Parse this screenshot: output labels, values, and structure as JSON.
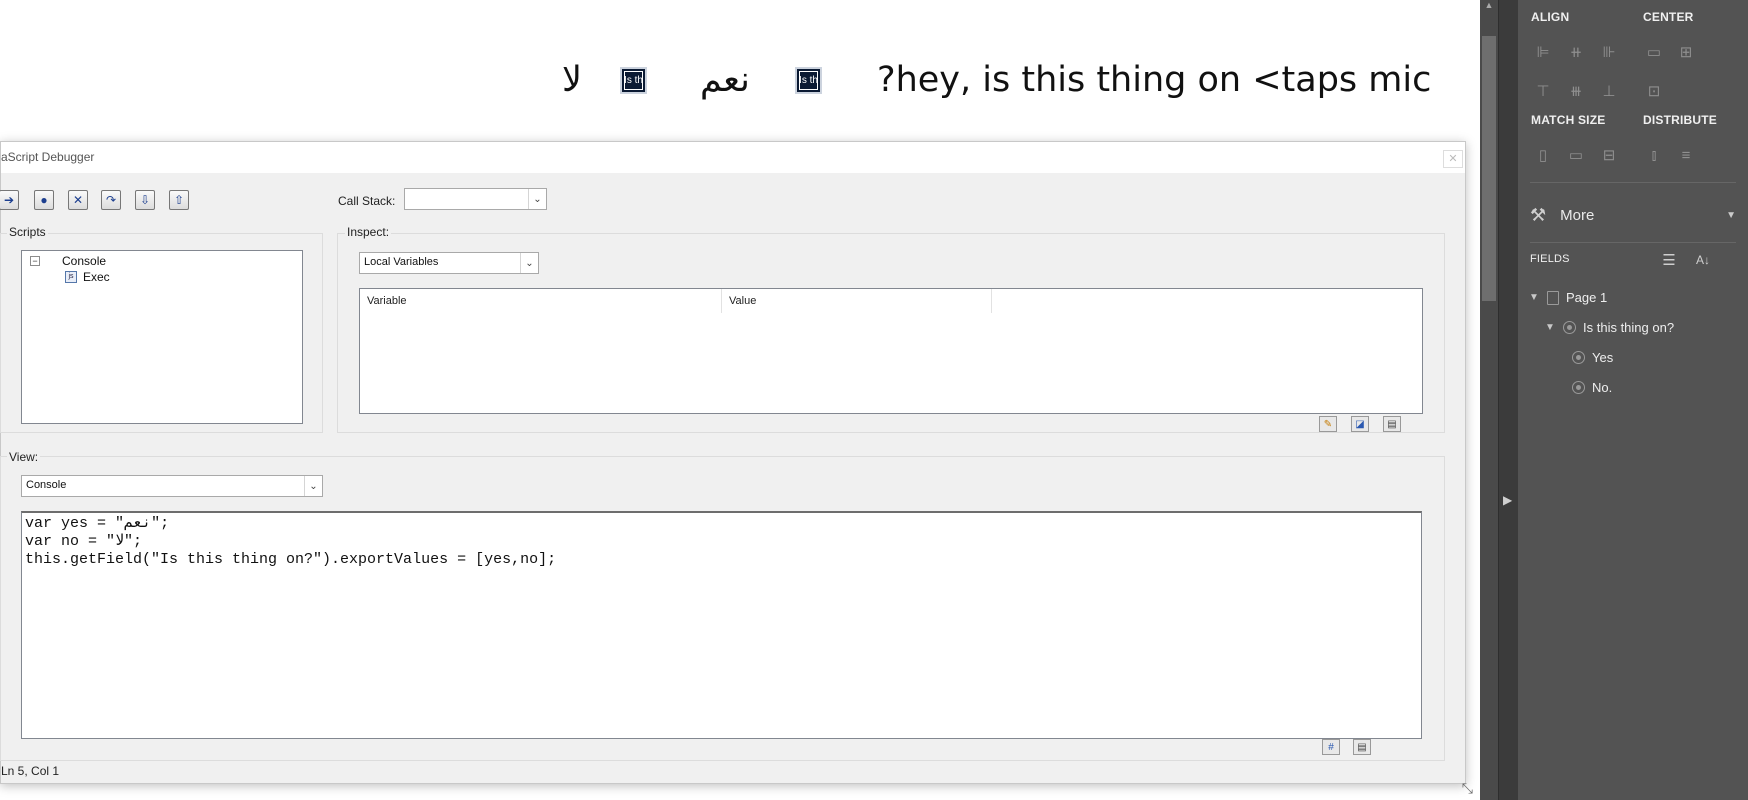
{
  "document": {
    "question_text": "?hey, is this thing on <taps mic",
    "yes_text": "نعم",
    "no_text": "لا",
    "radio_caption": "Is th"
  },
  "debugger": {
    "title": "aScript Debugger",
    "close_glyph": "✕",
    "toolbar_icons": [
      "resume-icon",
      "breakpoint-icon",
      "clear-icon",
      "step-over-icon",
      "step-into-icon",
      "step-out-icon"
    ],
    "call_stack_label": "Call Stack:",
    "call_stack_value": "",
    "scripts_label": "Scripts",
    "tree": {
      "root": "Console",
      "child": "Exec"
    },
    "inspect_label": "Inspect:",
    "inspect_select": "Local Variables",
    "columns": [
      "Variable",
      "Value"
    ],
    "view_label": "View:",
    "view_select": "Console",
    "code_lines": [
      "var yes = \"نعم\";",
      "var no = \"لا\";",
      "this.getField(\"Is this thing on?\").exportValues = [yes,no];"
    ],
    "status": "Ln 5, Col 1"
  },
  "panel": {
    "align_title": "ALIGN",
    "center_title": "CENTER",
    "match_size_title": "MATCH SIZE",
    "distribute_title": "DISTRIBUTE",
    "more_label": "More",
    "fields_title": "FIELDS",
    "page_label": "Page 1",
    "group_label": "Is this thing on?",
    "option_yes": "Yes",
    "option_no": "No."
  }
}
